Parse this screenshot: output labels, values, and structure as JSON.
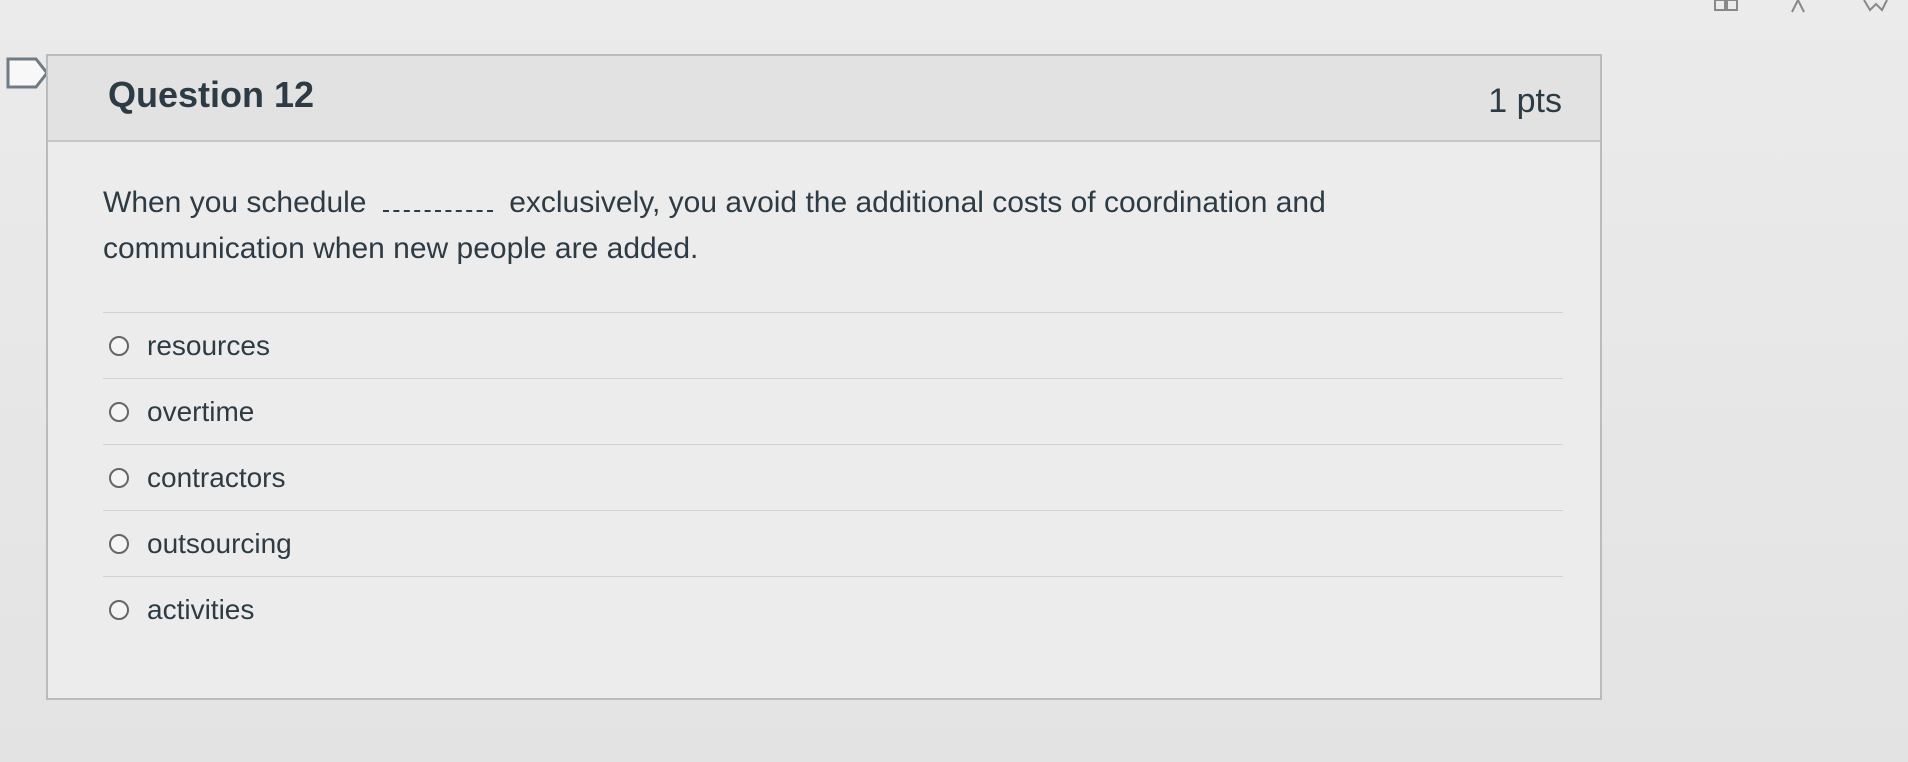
{
  "question": {
    "title": "Question 12",
    "points": "1 pts",
    "text_before": "When you schedule",
    "text_after": "exclusively, you avoid the additional costs of coordination and communication when new people are added."
  },
  "answers": [
    {
      "label": "resources"
    },
    {
      "label": "overtime"
    },
    {
      "label": "contractors"
    },
    {
      "label": "outsourcing"
    },
    {
      "label": "activities"
    }
  ],
  "icons": {
    "flag": "flag-icon",
    "top": [
      "grid-icon",
      "text-size-icon",
      "bookmark-icon"
    ]
  }
}
